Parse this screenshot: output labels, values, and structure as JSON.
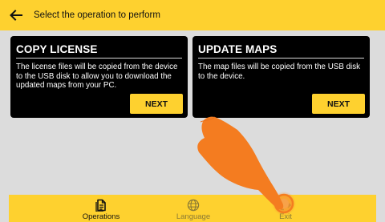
{
  "header": {
    "back_icon": "arrow-left-icon",
    "title": "Select the operation to perform"
  },
  "cards": [
    {
      "title": "COPY LICENSE",
      "description": "The license files will be copied from the device to the USB disk to allow you to download the updated maps from your PC.",
      "button_label": "NEXT"
    },
    {
      "title": "UPDATE MAPS",
      "description": "The map files will be copied from the USB disk to the device.",
      "button_label": "NEXT"
    }
  ],
  "nav": {
    "items": [
      {
        "label": "Operations",
        "icon": "document-icon",
        "active": true
      },
      {
        "label": "Language",
        "icon": "globe-icon",
        "active": false
      },
      {
        "label": "Exit",
        "icon": "exit-icon",
        "active": false
      }
    ]
  },
  "colors": {
    "accent": "#fed12f",
    "card_background": "#000000",
    "page_background": "#dcdcdc",
    "hand_overlay": "#f47c20"
  }
}
